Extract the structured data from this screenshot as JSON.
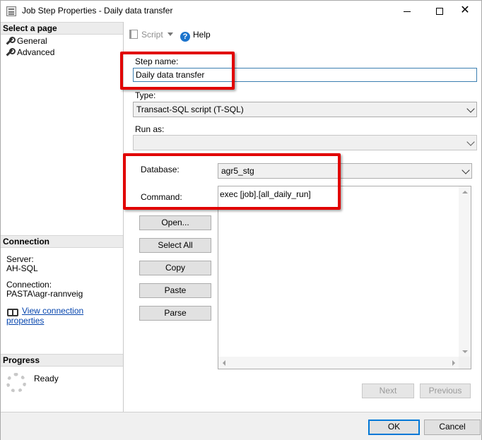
{
  "window": {
    "title": "Job Step Properties - Daily data transfer",
    "controls": {
      "minimize": "minimize",
      "maximize": "maximize",
      "close": "✕"
    }
  },
  "sidebar": {
    "select_page_header": "Select a page",
    "pages": [
      {
        "label": "General",
        "icon": "wrench-icon"
      },
      {
        "label": "Advanced",
        "icon": "wrench-icon"
      }
    ],
    "connection_header": "Connection",
    "server_label": "Server:",
    "server_value": "AH-SQL",
    "connection_label": "Connection:",
    "connection_value": "PASTA\\agr-rannveig",
    "view_connection_link": "View connection properties",
    "progress_header": "Progress",
    "progress_status": "Ready"
  },
  "toolbar": {
    "script_label": "Script",
    "help_label": "Help",
    "help_glyph": "?"
  },
  "form": {
    "step_name_label": "Step name:",
    "step_name_value": "Daily data transfer",
    "type_label": "Type:",
    "type_value": "Transact-SQL script (T-SQL)",
    "run_as_label": "Run as:",
    "run_as_value": "",
    "database_label": "Database:",
    "database_value": "agr5_stg",
    "command_label": "Command:",
    "command_value": "exec [job].[all_daily_run]"
  },
  "command_buttons": {
    "open": "Open...",
    "select_all": "Select All",
    "copy": "Copy",
    "paste": "Paste",
    "parse": "Parse"
  },
  "nav_buttons": {
    "next": "Next",
    "previous": "Previous"
  },
  "footer": {
    "ok": "OK",
    "cancel": "Cancel"
  },
  "colors": {
    "highlight": "#e10000",
    "link": "#0645ad",
    "accent": "#0078d7"
  }
}
